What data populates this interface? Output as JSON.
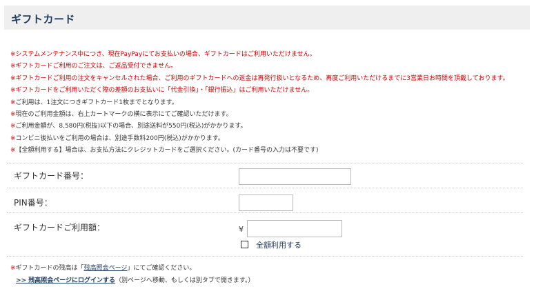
{
  "header": {
    "title": "ギフトカード"
  },
  "notes": [
    {
      "mark": "※",
      "text": "システムメンテナンス中につき、現在PayPayにてお支払いの場合、ギフトカードはご利用いただけません。",
      "color": "red"
    },
    {
      "mark": "※",
      "text": "ギフトカードご利用のご注文は、ご返品受付できません。",
      "color": "red"
    },
    {
      "mark": "※",
      "text": "ギフトカードご利用の注文をキャンセルされた場合、ご利用のギフトカードへの返金は再発行扱いとなるため、再度ご利用いただけるまでに3営業日お時間を頂戴しております。",
      "color": "red"
    },
    {
      "mark": "※",
      "text": "ギフトカードをご利用いただく際の差額のお支払いに「代金引換」・「銀行振込」はご利用いただけません。",
      "color": "red"
    },
    {
      "mark": "※",
      "text": "ご利用は、1注文につきギフトカード1枚までとなります。",
      "color": "dark"
    },
    {
      "mark": "※",
      "text": "現在のご利用金額は、右上カートマークの横に表示にてご確認いただけます。",
      "color": "dark"
    },
    {
      "mark": "※",
      "text": "ご利用金額が、8,580円(税抜)以下の場合、別途送料が550円(税込)がかかります。",
      "color": "dark"
    },
    {
      "mark": "※",
      "text": "コンビニ後払いをご利用の場合は、別途手数料200円(税込)がかかります。",
      "color": "dark"
    },
    {
      "mark": "※",
      "text": "【全額利用する】場合は、お支払方法にクレジットカードをご選択ください。(カード番号の入力は不要です)",
      "color": "dark"
    }
  ],
  "form": {
    "card_number_label": "ギフトカード番号：",
    "card_number_value": "",
    "pin_label": "PIN番号：",
    "pin_value": "",
    "amount_label": "ギフトカードご利用額：",
    "currency_symbol": "¥",
    "amount_value": "",
    "use_full_label": "全額利用する"
  },
  "balance": {
    "mark": "※",
    "prefix": "ギフトカードの残高は「",
    "link_text": "残高照会ページ",
    "suffix": "」にてご確認ください。",
    "login_link": ">> 残高照会ページにログインする",
    "login_note": "（別ページへ移動、もしくは別タブで開きます。）"
  },
  "colors": {
    "red": "#cc0000",
    "navy": "#1e3a5c",
    "header_bg": "#efefef"
  }
}
